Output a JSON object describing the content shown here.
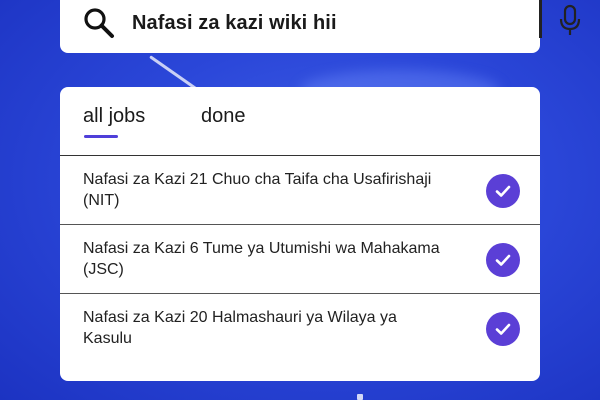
{
  "search": {
    "query": "Nafasi za kazi wiki hii",
    "left_icon": "search-icon",
    "right_icon": "mic-icon"
  },
  "tabs": [
    {
      "label": "all jobs",
      "selected": true
    },
    {
      "label": "done",
      "selected": false
    }
  ],
  "jobs": [
    {
      "title": "Nafasi za Kazi 21 Chuo cha Taifa cha Usafirishaji (NIT)",
      "status_icon": "check-circle-icon"
    },
    {
      "title": "Nafasi za Kazi 6 Tume ya Utumishi wa Mahakama (JSC)",
      "status_icon": "check-circle-icon"
    },
    {
      "title": "Nafasi za Kazi 20 Halmashauri ya Wilaya ya Kasulu",
      "status_icon": "check-circle-icon"
    }
  ],
  "colors": {
    "accent": "#5b3fd6",
    "background": "#2b47d9",
    "card": "#ffffff"
  }
}
